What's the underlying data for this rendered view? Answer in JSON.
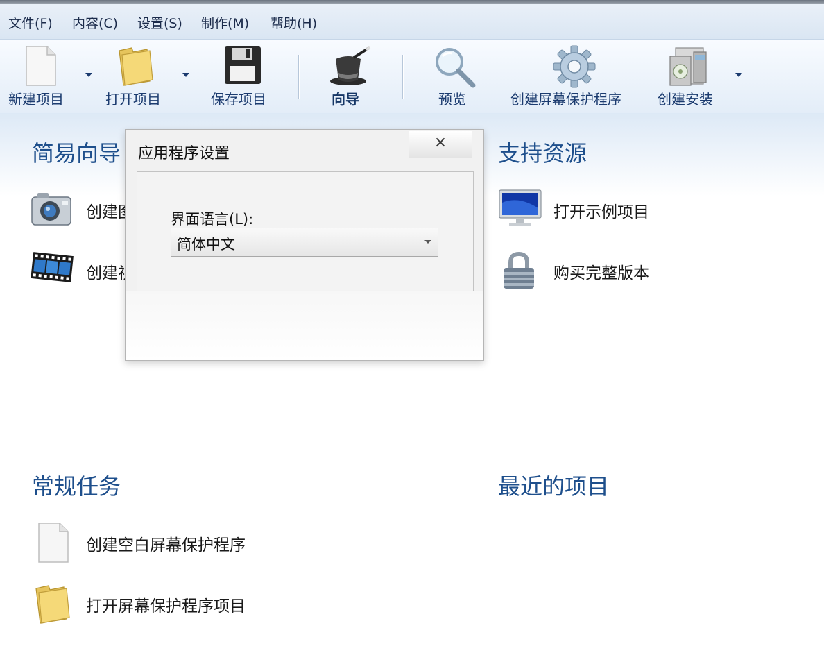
{
  "menu": [
    "文件(F)",
    "内容(C)",
    "设置(S)",
    "制作(M)",
    "帮助(H)"
  ],
  "toolbar": {
    "new_project": "新建项目",
    "open_project": "打开项目",
    "save_project": "保存项目",
    "wizard": "向导",
    "preview": "预览",
    "create_screensaver": "创建屏幕保护程序",
    "create_install": "创建安装"
  },
  "sections": {
    "easy_wizard": {
      "title": "简易向导",
      "items": [
        "创建图",
        "创建视"
      ]
    },
    "support": {
      "title": "支持资源",
      "items": [
        "打开示例项目",
        "购买完整版本"
      ]
    },
    "common_tasks": {
      "title": "常规任务",
      "items": [
        "创建空白屏幕保护程序",
        "打开屏幕保护程序项目"
      ]
    },
    "recent": {
      "title": "最近的项目"
    }
  },
  "dialog": {
    "title": "应用程序设置",
    "close": "×",
    "language_label": "界面语言(L):",
    "language_value": "简体中文"
  },
  "colors": {
    "accent": "#1e4f8c",
    "toolbar_text": "#1b3b6f"
  }
}
